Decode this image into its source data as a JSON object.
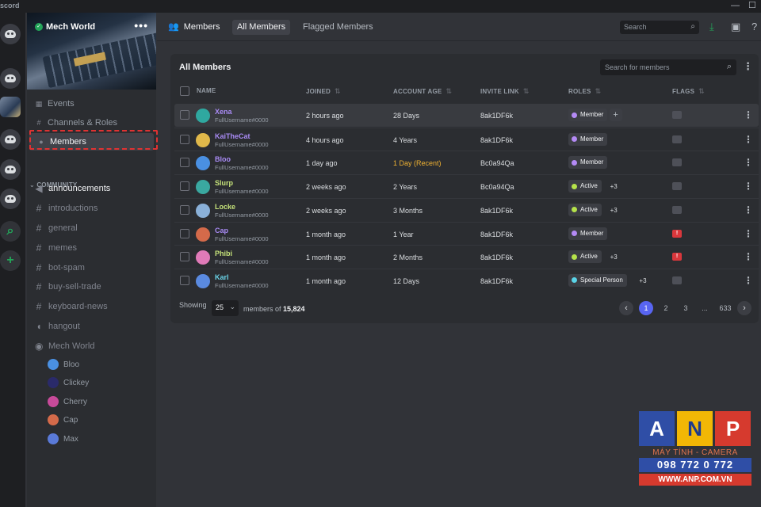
{
  "titlebar": {
    "app": "scord",
    "minimize": "—",
    "maximize": "☐"
  },
  "server": {
    "name": "Mech World",
    "more": "•••"
  },
  "sidebar": {
    "nav": [
      {
        "label": "Events",
        "icon": "calendar-icon"
      },
      {
        "label": "Channels & Roles",
        "icon": "channels-icon"
      },
      {
        "label": "Members",
        "icon": "members-icon"
      }
    ],
    "category": "COMMUNITY",
    "channels": [
      {
        "label": "announcements",
        "icon": "megaphone-icon",
        "glyph": "📢"
      },
      {
        "label": "introductions",
        "icon": "hash-icon",
        "glyph": "#"
      },
      {
        "label": "general",
        "icon": "hash-icon",
        "glyph": "#"
      },
      {
        "label": "memes",
        "icon": "hash-icon",
        "glyph": "#"
      },
      {
        "label": "bot-spam",
        "icon": "hash-icon",
        "glyph": "#"
      },
      {
        "label": "buy-sell-trade",
        "icon": "hash-icon",
        "glyph": "#"
      },
      {
        "label": "keyboard-news",
        "icon": "hash-icon",
        "glyph": "#"
      },
      {
        "label": "hangout",
        "icon": "speaker-icon",
        "glyph": "🔊"
      },
      {
        "label": "Mech World",
        "icon": "stage-icon",
        "glyph": "◉"
      }
    ],
    "voice_users": [
      {
        "name": "Bloo",
        "color": "#4a90e2"
      },
      {
        "name": "Clickey",
        "color": "#2a2a6a"
      },
      {
        "name": "Cherry",
        "color": "#c84a9a"
      },
      {
        "name": "Cap",
        "color": "#d46a4a"
      },
      {
        "name": "Max",
        "color": "#5a7ad8"
      }
    ]
  },
  "header": {
    "title": "Members",
    "tabs": [
      "All Members",
      "Flagged Members"
    ],
    "search_placeholder": "Search"
  },
  "panel": {
    "title": "All Members",
    "search_placeholder": "Search for members",
    "columns": [
      "NAME",
      "JOINED",
      "ACCOUNT AGE",
      "INVITE LINK",
      "ROLES",
      "FLAGS"
    ],
    "rows": [
      {
        "name": "Xena",
        "tag": "FullUsername#0000",
        "name_color": "#a98bf5",
        "avatar": "#2fa8a0",
        "joined": "2 hours ago",
        "age": "28 Days",
        "age_color": "#dbdee1",
        "invite": "8ak1DF6k",
        "role": "Member",
        "role_color": "#b48af5",
        "extra": "",
        "add": "+",
        "flag": "",
        "hover": true
      },
      {
        "name": "KaiTheCat",
        "tag": "FullUsername#0000",
        "name_color": "#a98bf5",
        "avatar": "#e0b84a",
        "joined": "4 hours ago",
        "age": "4 Years",
        "age_color": "#dbdee1",
        "invite": "8ak1DF6k",
        "role": "Member",
        "role_color": "#b48af5",
        "extra": "",
        "add": "",
        "flag": "",
        "hover": false
      },
      {
        "name": "Bloo",
        "tag": "FullUsername#0000",
        "name_color": "#a98bf5",
        "avatar": "#4a90e2",
        "joined": "1 day ago",
        "age": "1 Day (Recent)",
        "age_color": "#f0b232",
        "invite": "Bc0a94Qa",
        "role": "Member",
        "role_color": "#b48af5",
        "extra": "",
        "add": "",
        "flag": "",
        "hover": false
      },
      {
        "name": "Slurp",
        "tag": "FullUsername#0000",
        "name_color": "#c6e37a",
        "avatar": "#3aa8a0",
        "joined": "2 weeks ago",
        "age": "2 Years",
        "age_color": "#dbdee1",
        "invite": "Bc0a94Qa",
        "role": "Active",
        "role_color": "#b5e24a",
        "extra": "+3",
        "add": "",
        "flag": "",
        "hover": false
      },
      {
        "name": "Locke",
        "tag": "FullUsername#0000",
        "name_color": "#c6e37a",
        "avatar": "#8ab0d8",
        "joined": "2 weeks ago",
        "age": "3 Months",
        "age_color": "#dbdee1",
        "invite": "8ak1DF6k",
        "role": "Active",
        "role_color": "#b5e24a",
        "extra": "+3",
        "add": "",
        "flag": "",
        "hover": false
      },
      {
        "name": "Cap",
        "tag": "FullUsername#0000",
        "name_color": "#a98bf5",
        "avatar": "#d46a4a",
        "joined": "1 month ago",
        "age": "1 Year",
        "age_color": "#dbdee1",
        "invite": "8ak1DF6k",
        "role": "Member",
        "role_color": "#b48af5",
        "extra": "",
        "add": "",
        "flag": "!",
        "hover": false
      },
      {
        "name": "Phibi",
        "tag": "FullUsername#0000",
        "name_color": "#c6e37a",
        "avatar": "#e07ab8",
        "joined": "1 month ago",
        "age": "2 Months",
        "age_color": "#dbdee1",
        "invite": "8ak1DF6k",
        "role": "Active",
        "role_color": "#b5e24a",
        "extra": "+3",
        "add": "",
        "flag": "!",
        "hover": false
      },
      {
        "name": "Karl",
        "tag": "FullUsername#0000",
        "name_color": "#6ad4e8",
        "avatar": "#5a8ae0",
        "joined": "1 month ago",
        "age": "12 Days",
        "age_color": "#dbdee1",
        "invite": "8ak1DF6k",
        "role": "Special Person",
        "role_color": "#5ad4e8",
        "extra": "+3",
        "add": "",
        "flag": "",
        "hover": false
      }
    ],
    "footer": {
      "showing": "Showing",
      "page_size": "25",
      "members_of": "members of",
      "total": "15,824",
      "pages": [
        "1",
        "2",
        "3",
        "...",
        "633"
      ],
      "prev": "‹",
      "next": "›"
    }
  },
  "watermark": {
    "letters": [
      "A",
      "N",
      "P"
    ],
    "tagline": "MÁY TÍNH - CAMERA",
    "phone": "098 772 0 772",
    "url": "WWW.ANP.COM.VN"
  }
}
